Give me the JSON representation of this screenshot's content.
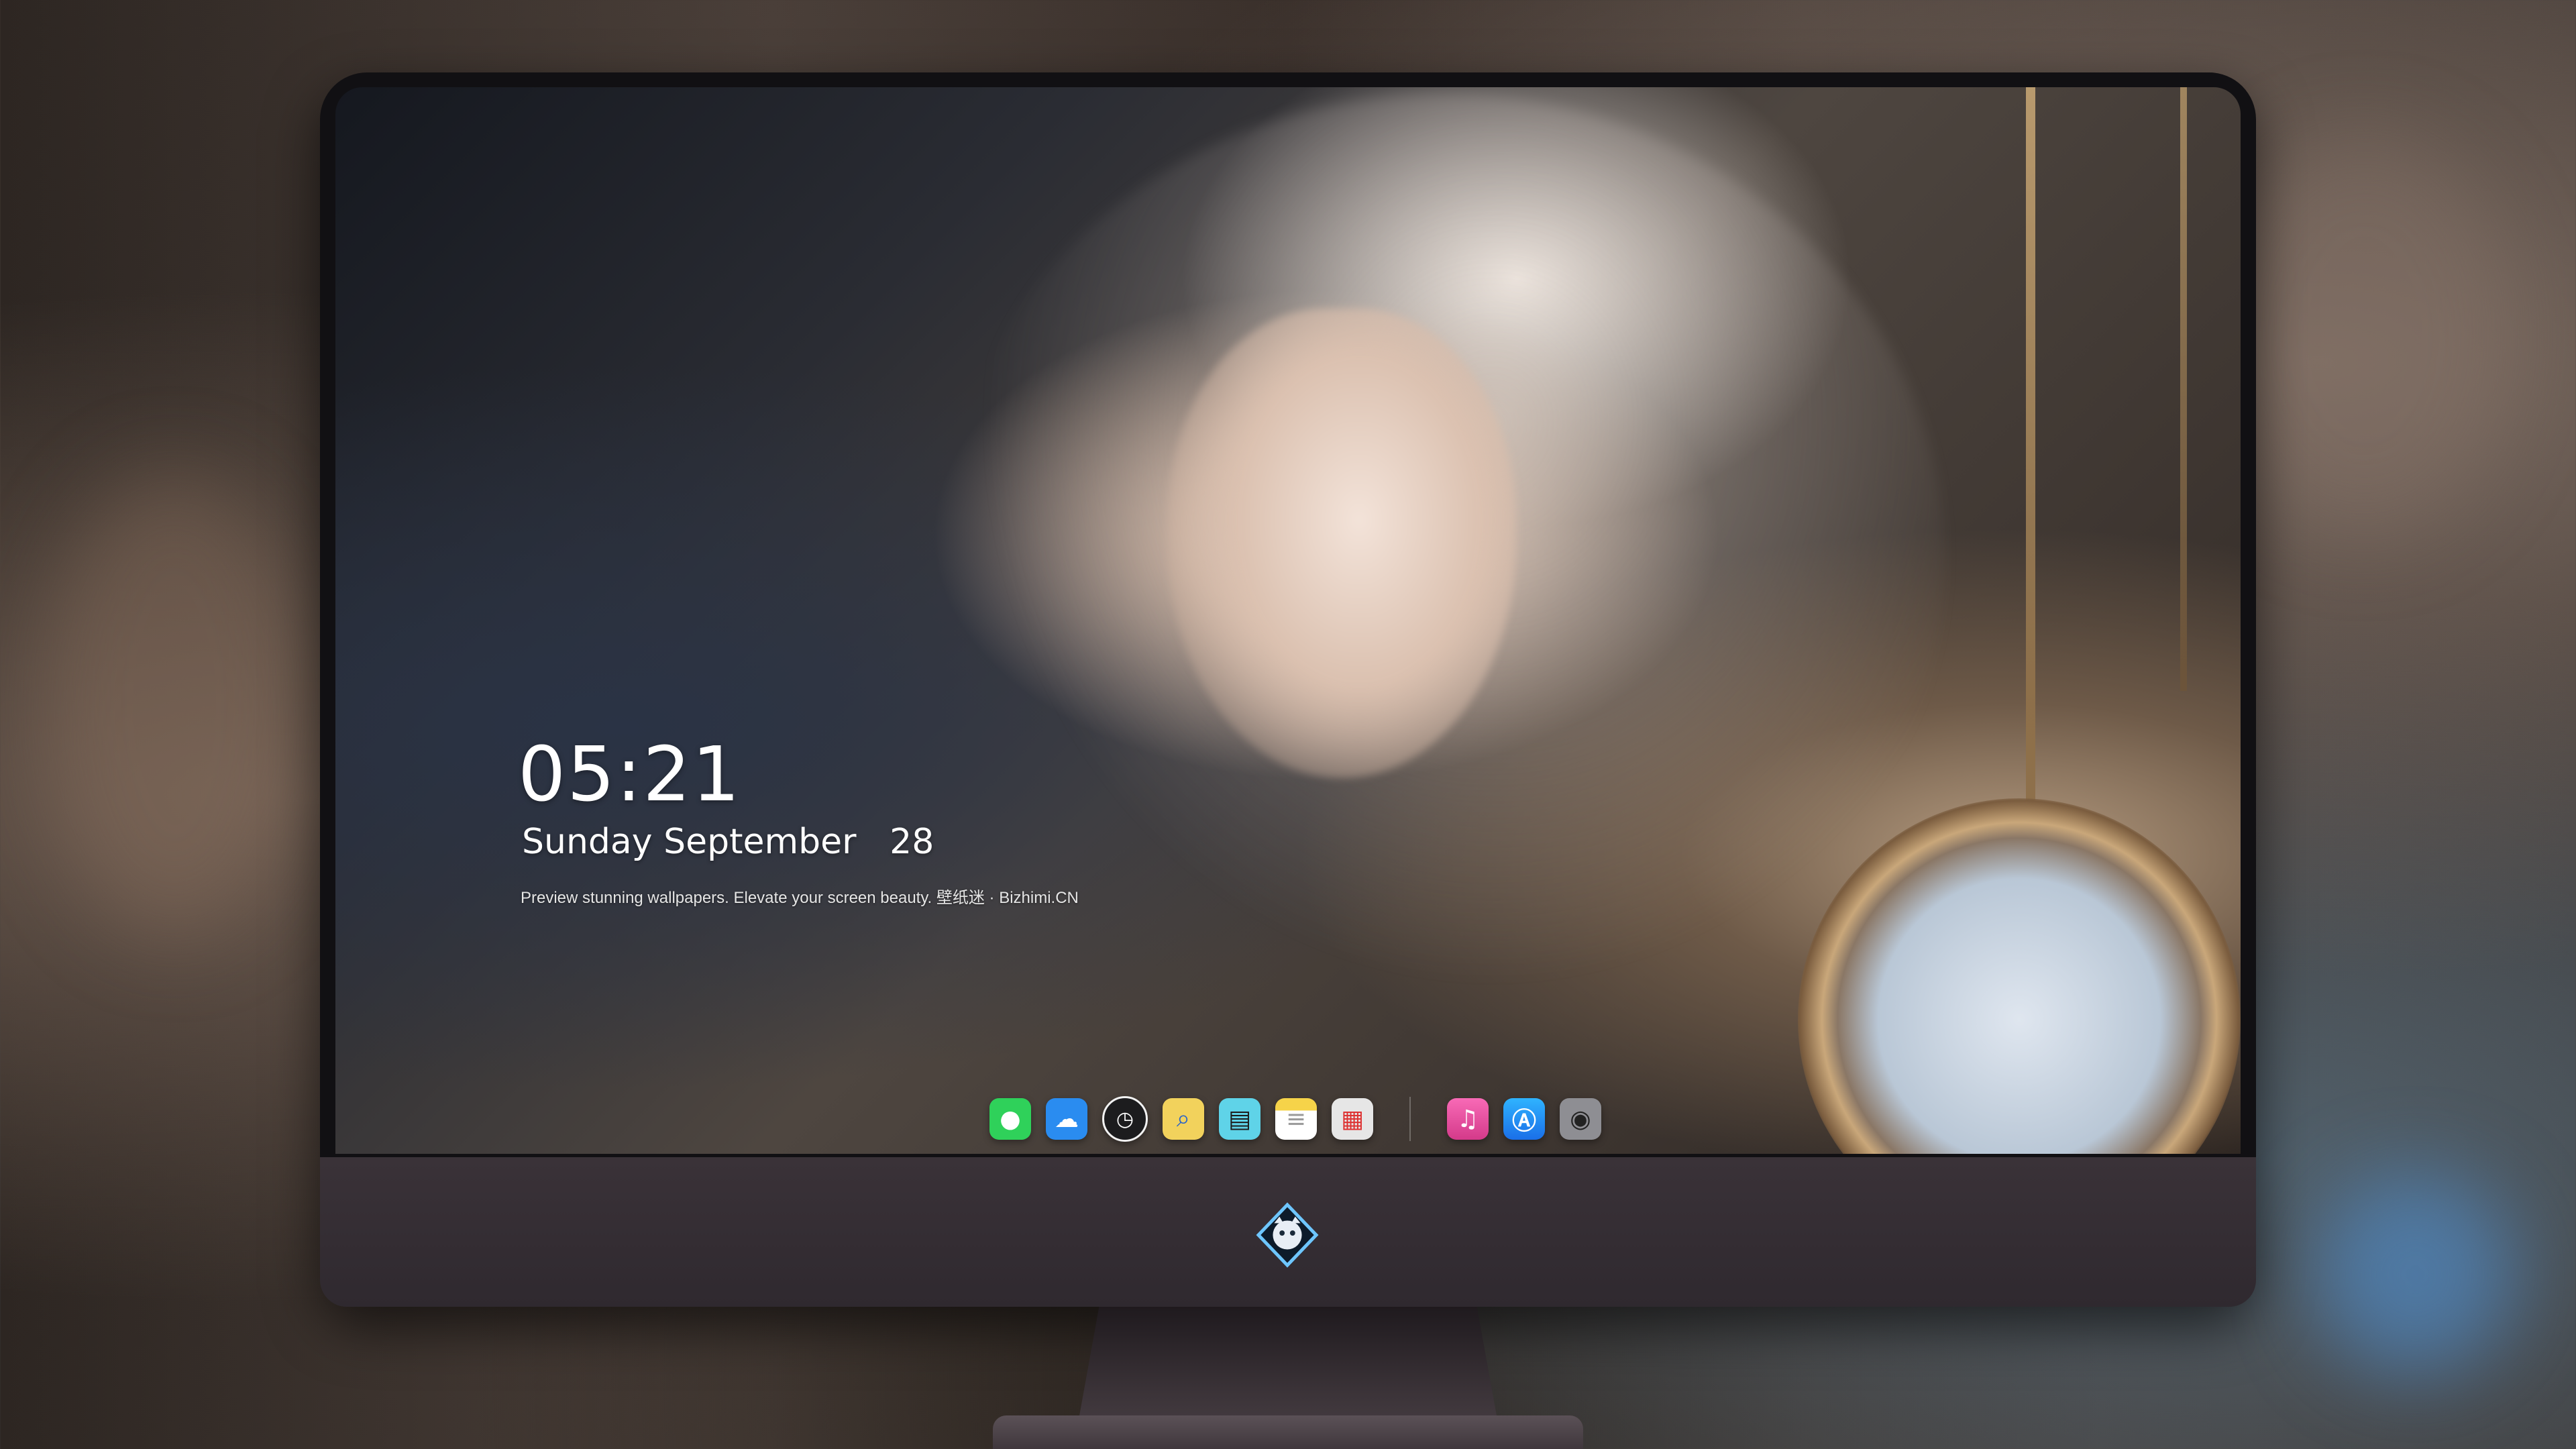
{
  "lockscreen": {
    "time": "05:21",
    "date": "Sunday September   28",
    "tagline": "Preview stunning wallpapers. Elevate your screen beauty. 壁纸迷 · Bizhimi.CN"
  },
  "dock": {
    "apps": [
      {
        "name": "messages-icon",
        "glyph": "💬",
        "color": "#2fd15a"
      },
      {
        "name": "weather-icon",
        "glyph": "☁",
        "color": "#2a8cf0"
      },
      {
        "name": "clock-icon",
        "glyph": "🕓",
        "color": "#f2f2f2"
      },
      {
        "name": "preview-icon",
        "glyph": "🔍",
        "color": "#f2d25c"
      },
      {
        "name": "clips-icon",
        "glyph": "🎬",
        "color": "#5fd3e8"
      },
      {
        "name": "notes-icon",
        "glyph": "≡",
        "color": "#f6d349"
      },
      {
        "name": "photo-booth-icon",
        "glyph": "▦",
        "color": "#e6e6e6"
      }
    ],
    "apps_right": [
      {
        "name": "music-icon",
        "glyph": "♫",
        "color": "#f14b9e"
      },
      {
        "name": "app-store-icon",
        "glyph": "A",
        "color": "#1e90ff"
      },
      {
        "name": "camera-icon",
        "glyph": "📷",
        "color": "#8e8e93"
      }
    ]
  }
}
